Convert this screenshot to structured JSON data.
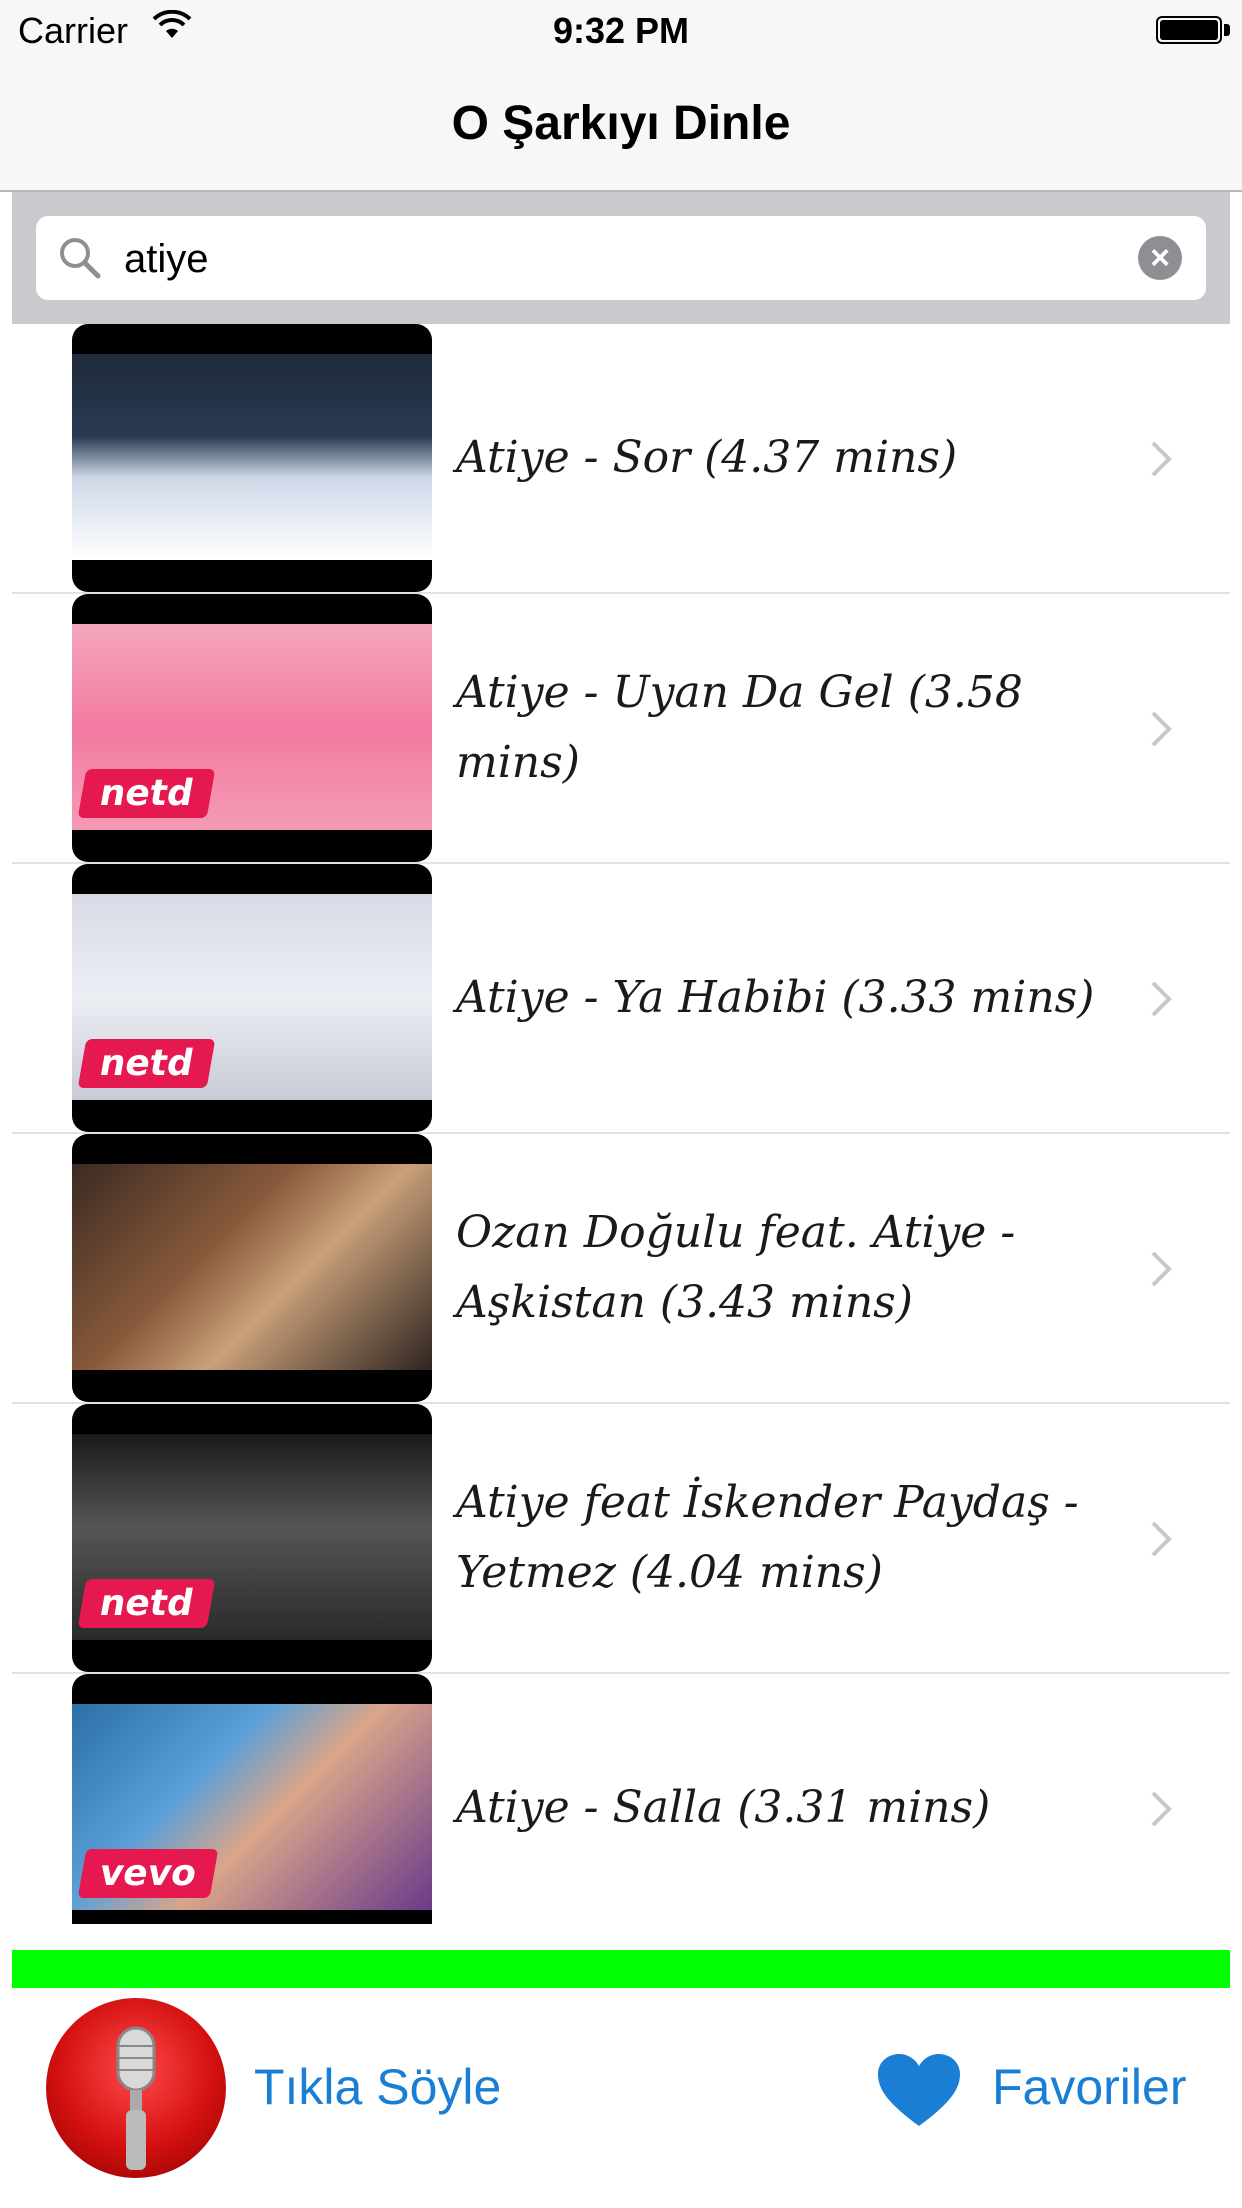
{
  "status_bar": {
    "carrier": "Carrier",
    "time": "9:32 PM"
  },
  "nav": {
    "title": "O Şarkıyı Dinle"
  },
  "search": {
    "value": "atiye"
  },
  "results": [
    {
      "title": "Atiye - Sor (4.37 mins)",
      "badge": ""
    },
    {
      "title": "Atiye - Uyan Da Gel (3.58 mins)",
      "badge": "netd"
    },
    {
      "title": "Atiye - Ya Habibi (3.33 mins)",
      "badge": "netd"
    },
    {
      "title": "Ozan Doğulu feat. Atiye - Aşkistan (3.43 mins)",
      "badge": ""
    },
    {
      "title": "Atiye feat  İskender Paydaş - Yetmez (4.04 mins)",
      "badge": "netd"
    },
    {
      "title": "Atiye - Salla (3.31 mins)",
      "badge": "vevo"
    }
  ],
  "toolbar": {
    "mic_label": "Tıkla Söyle",
    "favorites_label": "Favoriler"
  },
  "colors": {
    "accent": "#1a7fd4",
    "green_bar": "#00ff00",
    "badge": "#e5194f"
  },
  "icons": [
    "wifi-icon",
    "battery-icon",
    "search-icon",
    "clear-icon",
    "chevron-right-icon",
    "microphone-icon",
    "heart-icon"
  ]
}
